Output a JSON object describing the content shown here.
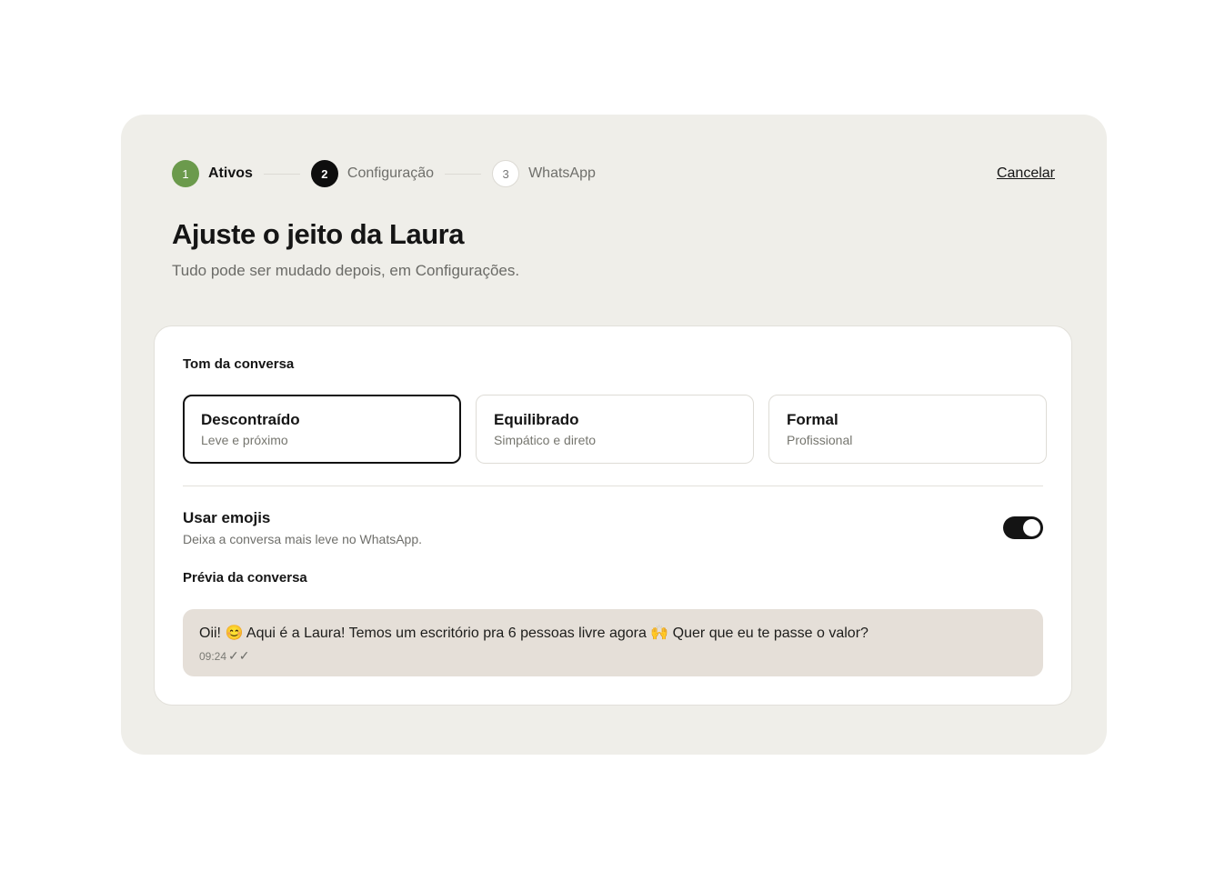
{
  "stepper": {
    "steps": [
      {
        "number": "1",
        "label": "Ativos"
      },
      {
        "number": "2",
        "label": "Configuração"
      },
      {
        "number": "3",
        "label": "WhatsApp"
      }
    ]
  },
  "header": {
    "cancel_label": "Cancelar",
    "title": "Ajuste o jeito da Laura",
    "subtitle": "Tudo pode ser mudado depois, em Configurações."
  },
  "tone": {
    "label": "Tom da conversa",
    "options": [
      {
        "title": "Descontraído",
        "description": "Leve e próximo"
      },
      {
        "title": "Equilibrado",
        "description": "Simpático e direto"
      },
      {
        "title": "Formal",
        "description": "Profissional"
      }
    ],
    "selected": "Descontraído"
  },
  "emojis": {
    "title": "Usar emojis",
    "description": "Deixa a conversa mais leve no WhatsApp.",
    "enabled": true
  },
  "preview": {
    "label": "Prévia da conversa",
    "message": "Oii! 😊 Aqui é a Laura! Temos um escritório pra 6 pessoas livre agora 🙌 Quer que eu te passe o valor?",
    "time": "09:24",
    "status_icon": "double-check-icon"
  },
  "colors": {
    "panel_bg": "#efeee9",
    "step_done": "#6b9a4c",
    "step_current": "#0e0e0e",
    "toggle_on": "#141414",
    "preview_bubble": "#e5dfd8"
  }
}
